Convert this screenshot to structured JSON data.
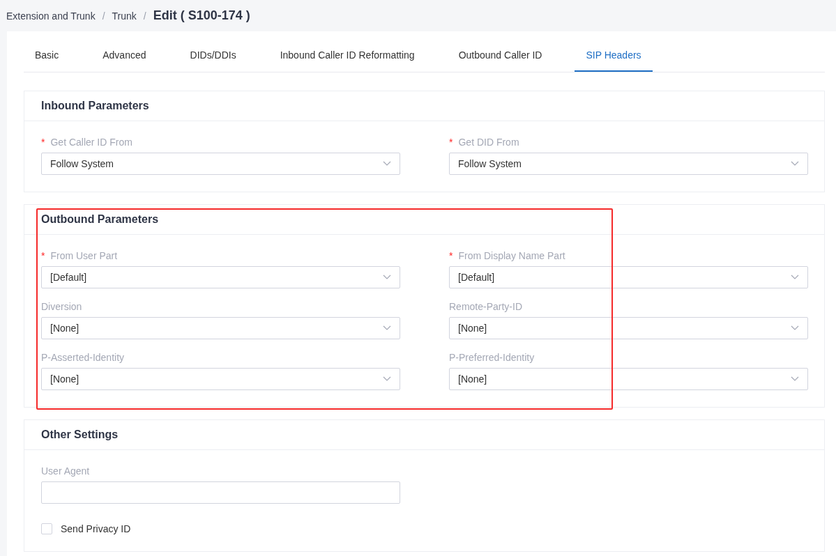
{
  "breadcrumb": [
    {
      "label": "Extension and Trunk",
      "current": false
    },
    {
      "separator": "/",
      "label": "Trunk",
      "current": false
    },
    {
      "separator": "/",
      "label": "Edit ( S100-174 )",
      "current": true
    }
  ],
  "tabs": [
    {
      "label": "Basic",
      "selected": false
    },
    {
      "label": "Advanced",
      "selected": false
    },
    {
      "label": "DIDs/DDIs",
      "selected": false
    },
    {
      "label": "Inbound Caller ID Reformatting",
      "selected": false
    },
    {
      "label": "Outbound Caller ID",
      "selected": false
    },
    {
      "label": "SIP Headers",
      "selected": true
    }
  ],
  "sections": [
    {
      "title": "Inbound Parameters",
      "highlighted": false,
      "fields": [
        {
          "kind": "select",
          "label": "Get Caller ID From",
          "required_mark": "*",
          "value": "Follow System"
        },
        {
          "kind": "select",
          "label": "Get DID From",
          "required_mark": "*",
          "value": "Follow System"
        }
      ]
    },
    {
      "title": "Outbound Parameters",
      "highlighted": true,
      "fields": [
        {
          "kind": "select",
          "label": "From User Part",
          "required_mark": "*",
          "value": "[Default]"
        },
        {
          "kind": "select",
          "label": "From Display Name Part",
          "required_mark": "*",
          "value": "[Default]"
        },
        {
          "kind": "select",
          "label": "Diversion",
          "value": "[None]"
        },
        {
          "kind": "select",
          "label": "Remote-Party-ID",
          "value": "[None]"
        },
        {
          "kind": "select",
          "label": "P-Asserted-Identity",
          "value": "[None]"
        },
        {
          "kind": "select",
          "label": "P-Preferred-Identity",
          "value": "[None]"
        }
      ]
    },
    {
      "title": "Other Settings",
      "highlighted": false,
      "fields": [
        {
          "kind": "text",
          "label": "User Agent"
        },
        {
          "kind": "checkbox",
          "label": "Send Privacy ID",
          "checked": false
        }
      ]
    }
  ]
}
